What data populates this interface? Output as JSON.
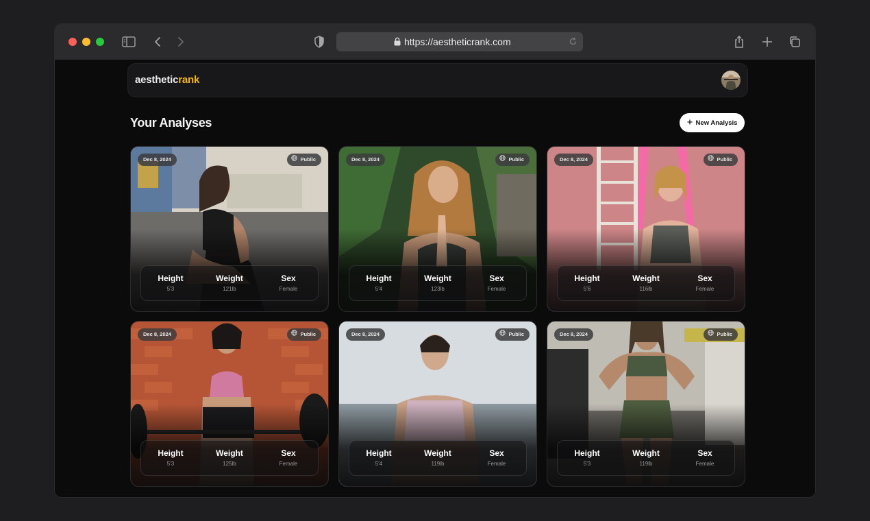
{
  "browser": {
    "url": "https://aestheticrank.com"
  },
  "brand": {
    "part1": "aesthetic",
    "part2": "rank",
    "accent": "#f2b705"
  },
  "page": {
    "title": "Your Analyses",
    "new_button": "New Analysis"
  },
  "labels": {
    "height": "Height",
    "weight": "Weight",
    "sex": "Sex",
    "visibility": "Public"
  },
  "cards": [
    {
      "date": "Dec 8, 2024",
      "visibility": "Public",
      "height": "5'3",
      "weight": "121lb",
      "sex": "Female"
    },
    {
      "date": "Dec 8, 2024",
      "visibility": "Public",
      "height": "5'4",
      "weight": "123lb",
      "sex": "Female"
    },
    {
      "date": "Dec 8, 2024",
      "visibility": "Public",
      "height": "5'6",
      "weight": "116lb",
      "sex": "Female"
    },
    {
      "date": "Dec 8, 2024",
      "visibility": "Public",
      "height": "5'3",
      "weight": "125lb",
      "sex": "Female"
    },
    {
      "date": "Dec 8, 2024",
      "visibility": "Public",
      "height": "5'4",
      "weight": "119lb",
      "sex": "Female"
    },
    {
      "date": "Dec 8, 2024",
      "visibility": "Public",
      "height": "5'3",
      "weight": "119lb",
      "sex": "Female"
    }
  ]
}
